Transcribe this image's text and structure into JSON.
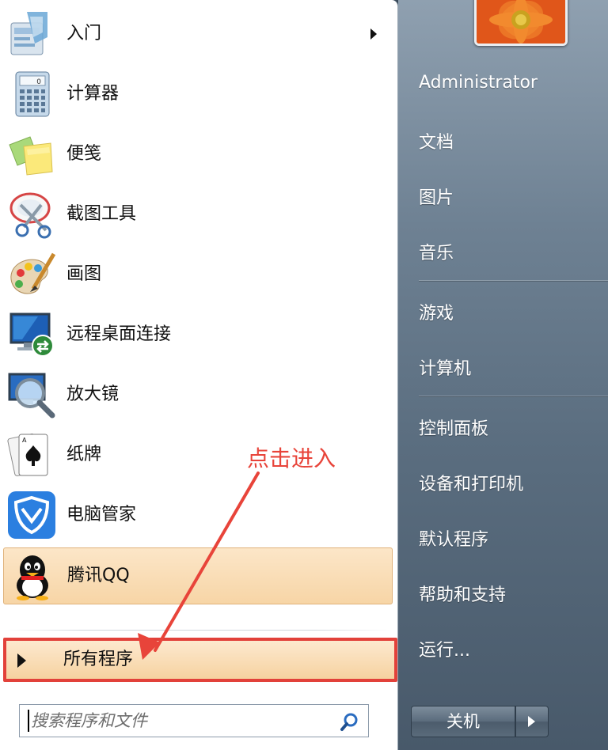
{
  "programs": [
    {
      "label": "入门",
      "icon": "getting-started-icon",
      "has_submenu": true
    },
    {
      "label": "计算器",
      "icon": "calculator-icon"
    },
    {
      "label": "便笺",
      "icon": "sticky-notes-icon"
    },
    {
      "label": "截图工具",
      "icon": "snipping-tool-icon"
    },
    {
      "label": "画图",
      "icon": "paint-icon"
    },
    {
      "label": "远程桌面连接",
      "icon": "remote-desktop-icon"
    },
    {
      "label": "放大镜",
      "icon": "magnifier-icon"
    },
    {
      "label": "纸牌",
      "icon": "solitaire-icon"
    },
    {
      "label": "电脑管家",
      "icon": "pc-manager-icon"
    },
    {
      "label": "腾讯QQ",
      "icon": "qq-icon",
      "highlighted": true
    }
  ],
  "all_programs": {
    "label": "所有程序"
  },
  "search": {
    "placeholder": "搜索程序和文件"
  },
  "right_menu": [
    {
      "label": "Administrator"
    },
    {
      "label": "文档"
    },
    {
      "label": "图片"
    },
    {
      "label": "音乐"
    },
    {
      "label": "游戏"
    },
    {
      "label": "计算机"
    },
    {
      "label": "控制面板"
    },
    {
      "label": "设备和打印机"
    },
    {
      "label": "默认程序"
    },
    {
      "label": "帮助和支持"
    },
    {
      "label": "运行..."
    }
  ],
  "shutdown": {
    "label": "关机"
  },
  "annotation": {
    "label": "点击进入",
    "color": "#e8443a"
  },
  "colors": {
    "highlight": "#f7d5a6",
    "annotation_border": "#e2413a"
  }
}
